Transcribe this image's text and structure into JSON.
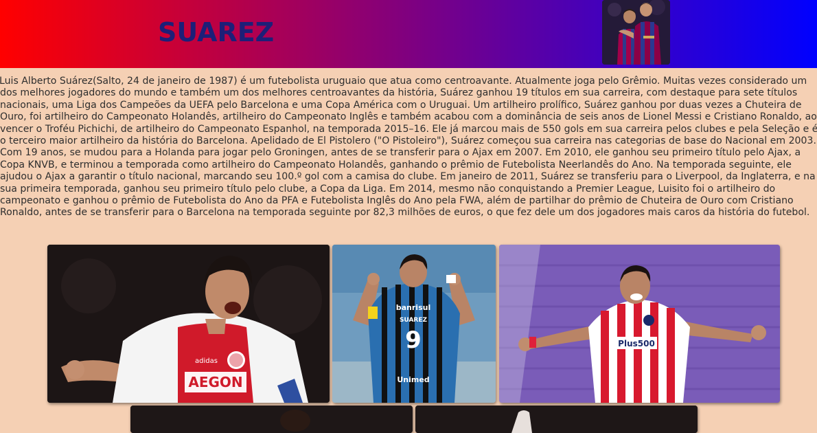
{
  "header": {
    "title": "SUAREZ",
    "gradient_start": "#ff0000",
    "gradient_end": "#0000ff",
    "title_color": "#1d1f78"
  },
  "bio": {
    "text": "Luis Alberto Suárez(Salto, 24 de janeiro de 1987) é um futebolista uruguaio que atua como centroavante. Atualmente joga pelo Grêmio. Muitas vezes considerado um dos melhores jogadores do mundo e também um dos melhores centroavantes da história, Suárez ganhou 19 títulos em sua carreira, com destaque para sete títulos nacionais, uma Liga dos Campeões da UEFA pelo Barcelona e uma Copa América com o Uruguai. Um artilheiro prolífico, Suárez ganhou por duas vezes a Chuteira de Ouro, foi artilheiro do Campeonato Holandês, artilheiro do Campeonato Inglês e também acabou com a dominância de seis anos de Lionel Messi e Cristiano Ronaldo, ao vencer o Troféu Pichichi, de artilheiro do Campeonato Espanhol, na temporada 2015–16. Ele já marcou mais de 550 gols em sua carreira pelos clubes e pela Seleção e é o terceiro maior artilheiro da história do Barcelona. Apelidado de El Pistolero (\"O Pistoleiro\"), Suárez começou sua carreira nas categorias de base do Nacional em 2003. Com 19 anos, se mudou para a Holanda para jogar pelo Groningen, antes de se transferir para o Ajax em 2007. Em 2010, ele ganhou seu primeiro título pelo Ajax, a Copa KNVB, e terminou a temporada como artilheiro do Campeonato Holandês, ganhando o prêmio de Futebolista Neerlandês do Ano. Na temporada seguinte, ele ajudou o Ajax a garantir o título nacional, marcando seu 100.º gol com a camisa do clube. Em janeiro de 2011, Suárez se transferiu para o Liverpool, da Inglaterra, e na sua primeira temporada, ganhou seu primeiro título pelo clube, a Copa da Liga. Em 2014, mesmo não conquistando a Premier League, Luisito foi o artilheiro do campeonato e ganhou o prêmio de Futebolista do Ano da PFA e Futebolista Inglês do Ano pela FWA, além de partilhar do prêmio de Chuteira de Ouro com Cristiano Ronaldo, antes de se transferir para o Barcelona na temporada seguinte por 82,3 milhões de euros, o que fez dele um dos jogadores mais caros da história do futebol."
  },
  "photos": {
    "ajax": {
      "shirt_sponsor": "AEGON",
      "shirt_brand": "adidas"
    },
    "gremio": {
      "shirt_sponsor": "banrisul",
      "shirt_name": "SUAREZ",
      "shirt_number": "9",
      "shirt_sponsor_2": "Unimed"
    },
    "atletico": {
      "shirt_sponsor": "Plus500"
    }
  },
  "background_color": "#f5d0b4"
}
